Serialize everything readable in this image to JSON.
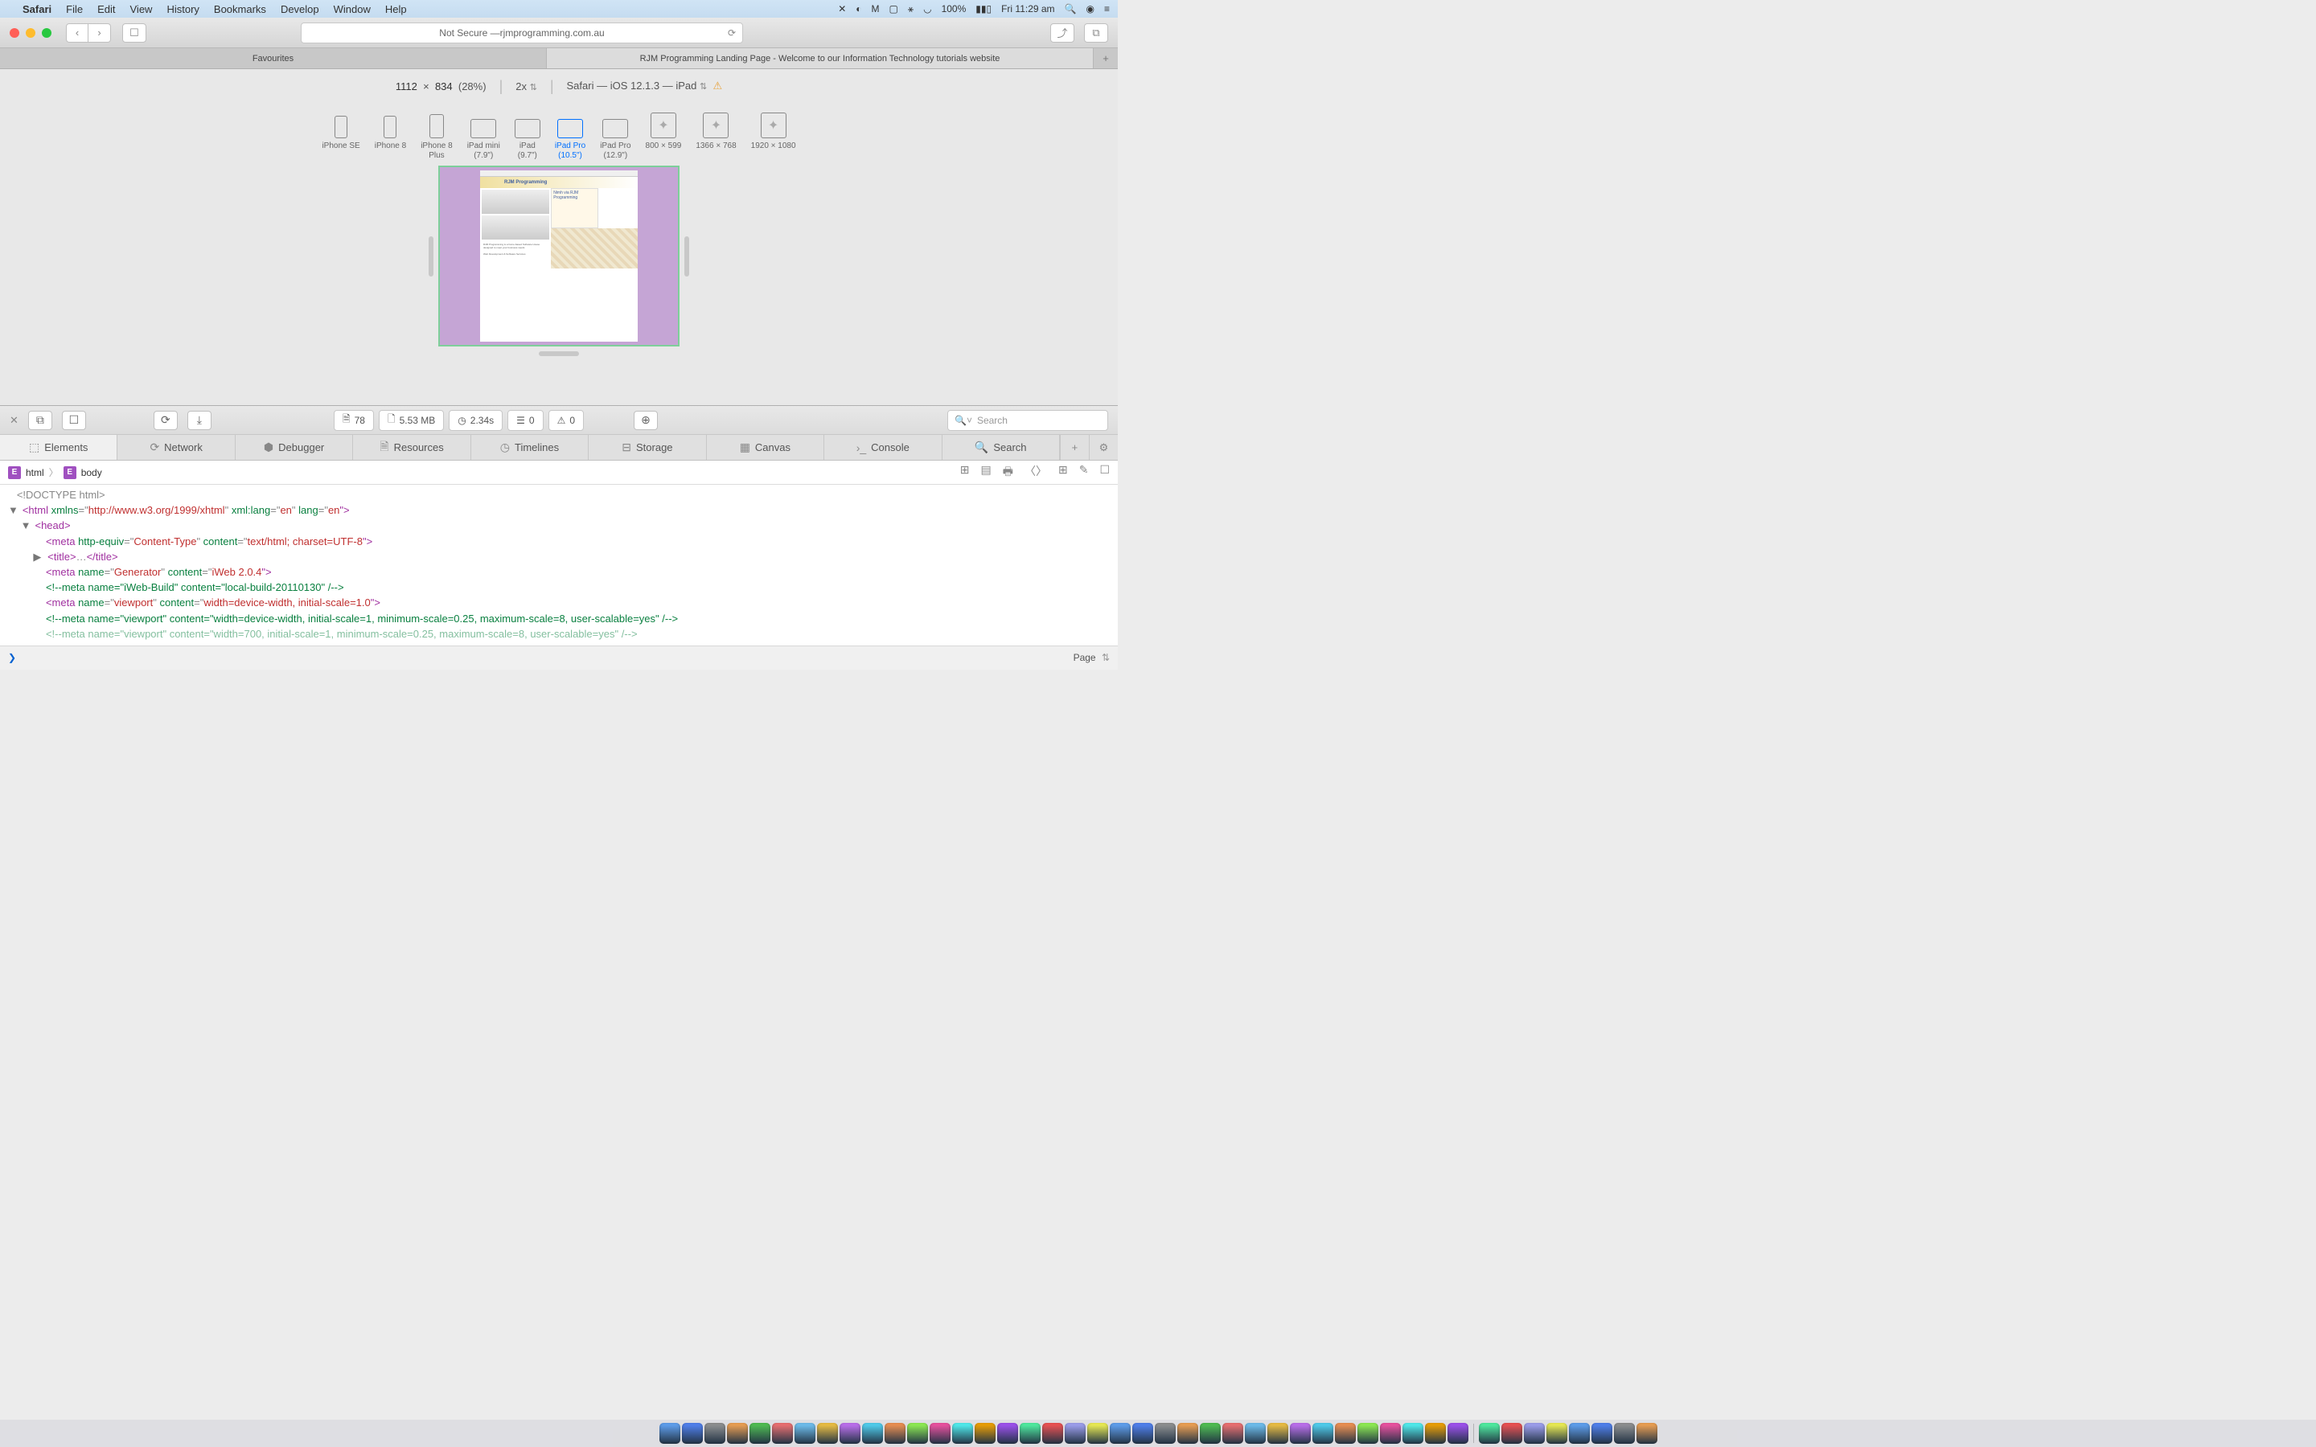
{
  "menubar": {
    "app": "Safari",
    "items": [
      "File",
      "Edit",
      "View",
      "History",
      "Bookmarks",
      "Develop",
      "Window",
      "Help"
    ],
    "battery": "100%",
    "clock": "Fri 11:29 am"
  },
  "toolbar": {
    "address_prefix": "Not Secure — ",
    "address": "rjmprogramming.com.au"
  },
  "tabs": {
    "fav": "Favourites",
    "active": "RJM Programming Landing Page - Welcome to our Information Technology tutorials website"
  },
  "rdm": {
    "width": "1112",
    "height": "834",
    "scale": "(28%)",
    "zoom": "2x",
    "ua": "Safari — iOS 12.1.3 — iPad",
    "devices": [
      {
        "label": "iPhone SE",
        "sub": "",
        "cls": "phone"
      },
      {
        "label": "iPhone 8",
        "sub": "",
        "cls": "phone"
      },
      {
        "label": "iPhone 8",
        "sub": "Plus",
        "cls": "phone-lg"
      },
      {
        "label": "iPad mini",
        "sub": "(7.9\")",
        "cls": "tablet"
      },
      {
        "label": "iPad",
        "sub": "(9.7\")",
        "cls": "tablet"
      },
      {
        "label": "iPad Pro",
        "sub": "(10.5\")",
        "cls": "tablet",
        "sel": true
      },
      {
        "label": "iPad Pro",
        "sub": "(12.9\")",
        "cls": "tablet"
      },
      {
        "label": "800 × 599",
        "sub": "",
        "cls": "square"
      },
      {
        "label": "1366 × 768",
        "sub": "",
        "cls": "square"
      },
      {
        "label": "1920 × 1080",
        "sub": "",
        "cls": "square"
      }
    ],
    "preview_title": "RJM Programming",
    "preview_nimh": "Nimh via RJM Programming"
  },
  "devtools": {
    "stats": {
      "resources": "78",
      "size": "5.53 MB",
      "time": "2.34s",
      "logs": "0",
      "warnings": "0"
    },
    "search_placeholder": "Search",
    "tabs": [
      "Elements",
      "Network",
      "Debugger",
      "Resources",
      "Timelines",
      "Storage",
      "Canvas",
      "Console",
      "Search"
    ],
    "crumb": [
      "html",
      "body"
    ],
    "scope": "Page",
    "code": {
      "l1": "<!DOCTYPE html>",
      "l2a": "<html ",
      "l2b": "xmlns",
      "l2c": "=\"",
      "l2d": "http://www.w3.org/1999/xhtml",
      "l2e": "\" ",
      "l2f": "xml:lang",
      "l2g": "=\"",
      "l2h": "en",
      "l2i": "\" ",
      "l2j": "lang",
      "l2k": "=\"",
      "l2l": "en",
      "l2m": "\">",
      "l3": "<head>",
      "l4a": "<meta ",
      "l4b": "http-equiv",
      "l4c": "=\"",
      "l4d": "Content-Type",
      "l4e": "\" ",
      "l4f": "content",
      "l4g": "=\"",
      "l4h": "text/html; charset=UTF-8",
      "l4i": "\">",
      "l5a": "<title>",
      "l5b": "…",
      "l5c": "</title>",
      "l6a": "<meta ",
      "l6b": "name",
      "l6c": "=\"",
      "l6d": "Generator",
      "l6e": "\" ",
      "l6f": "content",
      "l6g": "=\"",
      "l6h": "iWeb 2.0.4",
      "l6i": "\">",
      "l7": "<!--meta name=\"iWeb-Build\" content=\"local-build-20110130\" /-->",
      "l8a": "<meta ",
      "l8b": "name",
      "l8c": "=\"",
      "l8d": "viewport",
      "l8e": "\" ",
      "l8f": "content",
      "l8g": "=\"",
      "l8h": "width=device-width, initial-scale=1.0",
      "l8i": "\">",
      "l9": "<!--meta name=\"viewport\" content=\"width=device-width, initial-scale=1, minimum-scale=0.25, maximum-scale=8, user-scalable=yes\" /-->",
      "l10": "<!--meta name=\"viewport\" content=\"width=700, initial-scale=1, minimum-scale=0.25, maximum-scale=8, user-scalable=yes\" /-->"
    }
  }
}
